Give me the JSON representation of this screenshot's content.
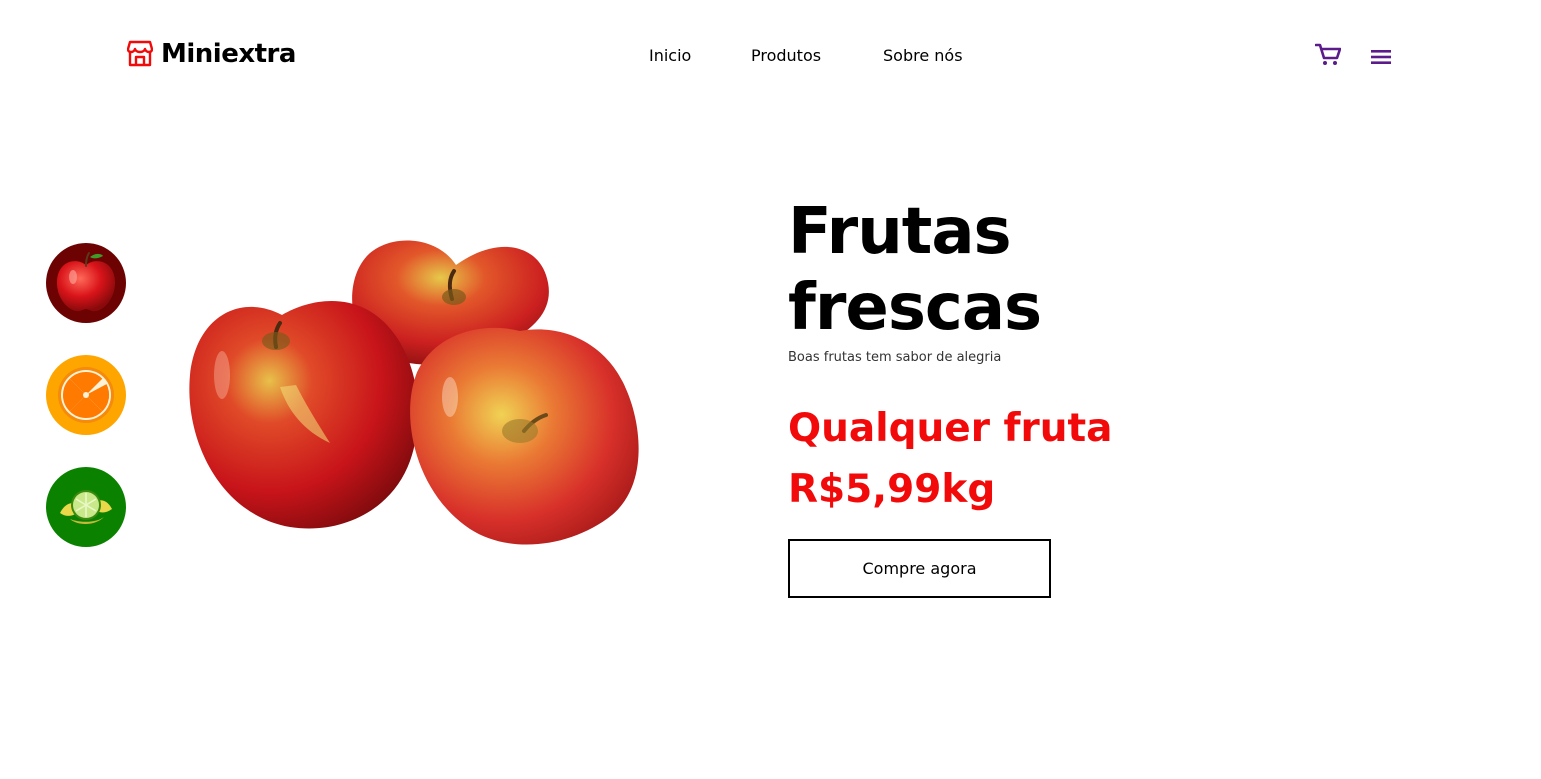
{
  "brand": {
    "name": "Miniextra",
    "icon": "store-icon",
    "color": "#f20a0a"
  },
  "nav": {
    "items": [
      "Inicio",
      "Produtos",
      "Sobre nós"
    ]
  },
  "header_actions": {
    "cart_icon": "cart-icon",
    "menu_icon": "hamburger-menu-icon",
    "icon_color": "#5b1b8a"
  },
  "thumbnails": [
    {
      "name": "apple",
      "icon": "apple-icon",
      "bg": "#6c0202"
    },
    {
      "name": "orange",
      "icon": "orange-slice-icon",
      "bg": "#fea500"
    },
    {
      "name": "lime",
      "icon": "lime-icon",
      "bg": "#0a8200"
    }
  ],
  "hero": {
    "title_line1": "Frutas",
    "title_line2": "frescas",
    "subtitle": "Boas frutas tem sabor de alegria",
    "price_line1": "Qualquer fruta",
    "price_line2": "R$5,99kg",
    "cta_label": "Compre agora",
    "accent": "#f20a0a"
  }
}
